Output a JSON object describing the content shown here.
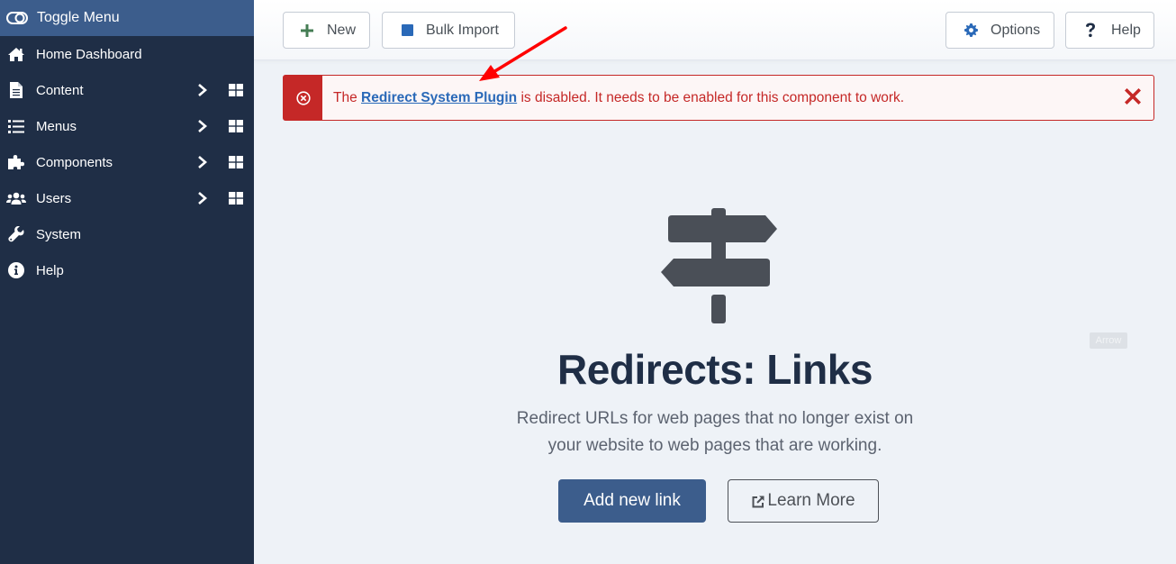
{
  "sidebar": {
    "toggle_label": "Toggle Menu",
    "items": [
      {
        "label": "Home Dashboard",
        "icon": "home-icon",
        "has_submenu": false
      },
      {
        "label": "Content",
        "icon": "file-icon",
        "has_submenu": true
      },
      {
        "label": "Menus",
        "icon": "list-icon",
        "has_submenu": true
      },
      {
        "label": "Components",
        "icon": "puzzle-icon",
        "has_submenu": true
      },
      {
        "label": "Users",
        "icon": "users-icon",
        "has_submenu": true
      },
      {
        "label": "System",
        "icon": "wrench-icon",
        "has_submenu": false
      },
      {
        "label": "Help",
        "icon": "info-icon",
        "has_submenu": false
      }
    ]
  },
  "toolbar": {
    "new_label": "New",
    "bulk_import_label": "Bulk Import",
    "options_label": "Options",
    "help_label": "Help"
  },
  "alert": {
    "prefix": "The ",
    "link_text": "Redirect System Plugin",
    "suffix": " is disabled. It needs to be enabled for this component to work."
  },
  "empty_state": {
    "title": "Redirects: Links",
    "description_line1": "Redirect URLs for web pages that no longer exist on",
    "description_line2": "your website to web pages that are working.",
    "primary_button": "Add new link",
    "secondary_button": "Learn More"
  },
  "annotation": {
    "label": "Arrow"
  },
  "colors": {
    "sidebar_bg": "#1f2e46",
    "sidebar_active": "#3c5d8c",
    "alert_red": "#c52827",
    "link_blue": "#2a69b8",
    "primary": "#3c5d8c",
    "annotation_arrow": "#ff0000"
  }
}
